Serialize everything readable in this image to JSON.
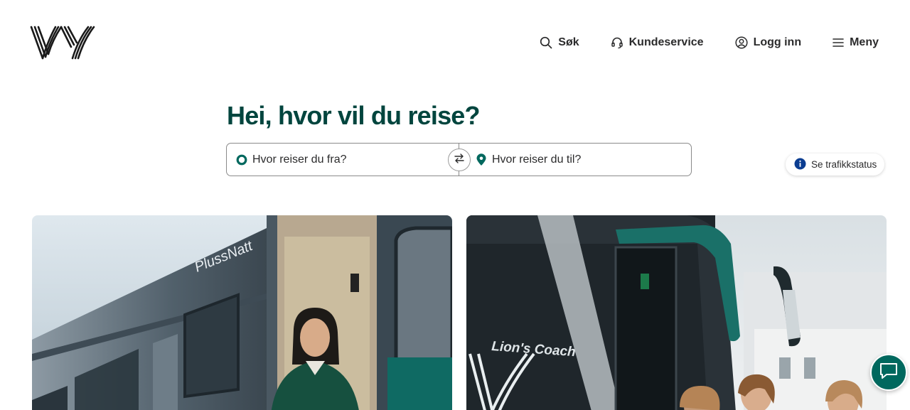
{
  "brand": {
    "logo": "Vy logo",
    "green": "#00453e",
    "accent": "#00685e"
  },
  "nav": {
    "search_label": "Søk",
    "customer_service_label": "Kundeservice",
    "login_label": "Logg inn",
    "menu_label": "Meny"
  },
  "hero": {
    "headline": "Hei, hvor vil du reise?"
  },
  "search": {
    "from_placeholder": "Hvor reiser du fra?",
    "to_placeholder": "Hvor reiser du til?",
    "from_value": "",
    "to_value": ""
  },
  "traffic": {
    "label": "Se trafikkstatus"
  },
  "cards": [
    {
      "image": "Train photo with conductor",
      "train_text": "PlussNatt"
    },
    {
      "image": "Bus photo with passengers",
      "bus_text": "Lion's Coach"
    }
  ],
  "icons": [
    "search-icon",
    "headset-icon",
    "user-icon",
    "menu-icon",
    "location-icon",
    "swap-icon",
    "info-icon",
    "chat-icon"
  ]
}
